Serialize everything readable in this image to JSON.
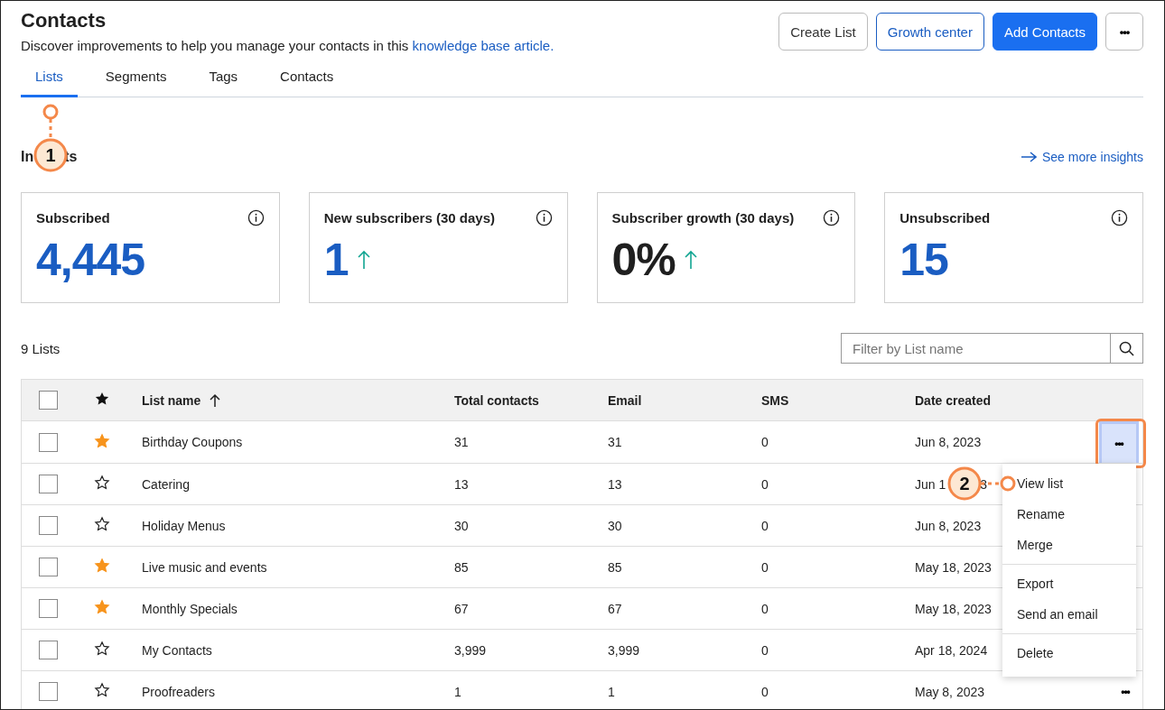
{
  "header": {
    "title": "Contacts",
    "subtitle": "Discover improvements to help you manage your contacts in this",
    "subtitle_link": "knowledge base article.",
    "buttons": [
      {
        "label": "Create List",
        "kind": "secondary"
      },
      {
        "label": "Growth center",
        "kind": "outline"
      },
      {
        "label": "Add Contacts",
        "kind": "primary"
      },
      {
        "label": "•••",
        "kind": "more"
      }
    ]
  },
  "tabs": [
    {
      "label": "Lists",
      "selected": true
    },
    {
      "label": "Segments",
      "selected": false
    },
    {
      "label": "Tags",
      "selected": false
    },
    {
      "label": "Contacts",
      "selected": false
    }
  ],
  "insights": {
    "title_parts": [
      "In",
      "ts"
    ],
    "link": "See more insights",
    "cards": [
      {
        "label": "Subscribed",
        "value": "4,445",
        "color": "#1a5dc2",
        "rising": false
      },
      {
        "label": "New subscribers (30 days)",
        "value": "1",
        "color": "#1a5dc2",
        "rising": true
      },
      {
        "label": "Subscriber growth (30 days)",
        "value": "0%",
        "color": "#1f1f1f",
        "rising": true
      },
      {
        "label": "Unsubscribed",
        "value": "15",
        "color": "#1a5dc2",
        "rising": false
      }
    ]
  },
  "lists": {
    "count": "9 Lists",
    "filter": {
      "placeholder": "Filter by List name"
    },
    "select_all_checked": false,
    "columns": [
      "List name",
      "Total contacts",
      "Email",
      "SMS",
      "Date created"
    ],
    "rows": [
      {
        "name": "Birthday Coupons",
        "total": "31",
        "email": "31",
        "sms": "0",
        "date": "Jun 8, 2023",
        "starred": true,
        "checked": false,
        "more": "•••",
        "menu_open": true
      },
      {
        "name": "Catering",
        "total": "13",
        "email": "13",
        "sms": "0",
        "date_parts": [
          "Jun 1",
          "3"
        ],
        "starred": false,
        "checked": false,
        "menu_open": false
      },
      {
        "name": "Holiday Menus",
        "total": "30",
        "email": "30",
        "sms": "0",
        "date": "Jun 8, 2023",
        "starred": false,
        "checked": false,
        "menu_open": false
      },
      {
        "name": "Live music and events",
        "total": "85",
        "email": "85",
        "sms": "0",
        "date": "May 18, 2023",
        "starred": true,
        "checked": false,
        "menu_open": false
      },
      {
        "name": "Monthly Specials",
        "total": "67",
        "email": "67",
        "sms": "0",
        "date": "May 18, 2023",
        "starred": true,
        "checked": false,
        "menu_open": false
      },
      {
        "name": "My Contacts",
        "total": "3,999",
        "email": "3,999",
        "sms": "0",
        "date": "Apr 18, 2024",
        "starred": false,
        "checked": false,
        "menu_open": false
      },
      {
        "name": "Proofreaders",
        "total": "1",
        "email": "1",
        "sms": "0",
        "date": "May 8, 2023",
        "starred": false,
        "checked": false,
        "more": "•••",
        "menu_open": false
      }
    ]
  },
  "menu": {
    "groups": [
      [
        "View list",
        "Rename",
        "Merge"
      ],
      [
        "Export",
        "Send an email"
      ],
      [
        "Delete"
      ]
    ]
  },
  "callouts": [
    {
      "label": "1"
    },
    {
      "label": "2"
    }
  ]
}
